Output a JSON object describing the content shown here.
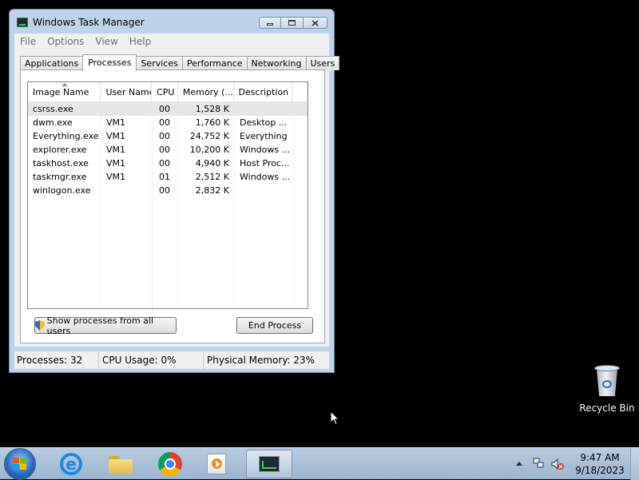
{
  "window": {
    "title": "Windows Task Manager",
    "menu": [
      "File",
      "Options",
      "View",
      "Help"
    ],
    "tabs": [
      "Applications",
      "Processes",
      "Services",
      "Performance",
      "Networking",
      "Users"
    ],
    "active_tab": "Processes",
    "columns": [
      "Image Name",
      "User Name",
      "CPU",
      "Memory (...",
      "Description"
    ],
    "rows": [
      {
        "image": "csrss.exe",
        "user": "",
        "cpu": "00",
        "memory": "1,528 K",
        "desc": ""
      },
      {
        "image": "dwm.exe",
        "user": "VM1",
        "cpu": "00",
        "memory": "1,760 K",
        "desc": "Desktop ..."
      },
      {
        "image": "Everything.exe",
        "user": "VM1",
        "cpu": "00",
        "memory": "24,752 K",
        "desc": "Everything"
      },
      {
        "image": "explorer.exe",
        "user": "VM1",
        "cpu": "00",
        "memory": "10,200 K",
        "desc": "Windows ..."
      },
      {
        "image": "taskhost.exe",
        "user": "VM1",
        "cpu": "00",
        "memory": "4,940 K",
        "desc": "Host Proc..."
      },
      {
        "image": "taskmgr.exe",
        "user": "VM1",
        "cpu": "01",
        "memory": "2,512 K",
        "desc": "Windows ..."
      },
      {
        "image": "winlogon.exe",
        "user": "",
        "cpu": "00",
        "memory": "2,832 K",
        "desc": ""
      }
    ],
    "show_all_label": "Show processes from all users",
    "end_process_label": "End Process",
    "status": {
      "processes": "Processes: 32",
      "cpu": "CPU Usage: 0%",
      "memory": "Physical Memory: 23%"
    }
  },
  "desktop": {
    "recycle_bin_label": "Recycle Bin"
  },
  "taskbar": {
    "time": "9:47 AM",
    "date": "9/18/2023",
    "pinned": [
      "windows-explorer",
      "internet-explorer",
      "file-explorer",
      "google-chrome",
      "media-player",
      "task-manager"
    ]
  },
  "colors": {
    "window_frame": "#bcd3ea",
    "desktop_bg": "#000000",
    "taskbar": "#b3c7de"
  }
}
